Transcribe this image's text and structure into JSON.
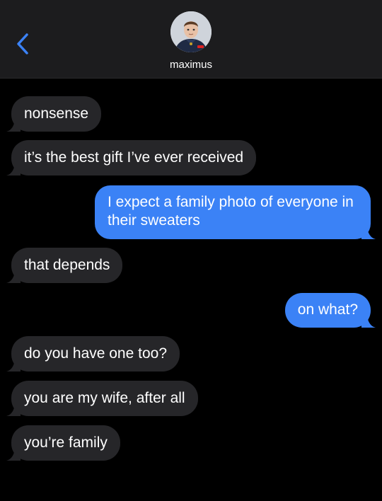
{
  "header": {
    "contact_name": "maximus",
    "back_icon": "chevron-left-icon",
    "avatar_icon": "contact-avatar"
  },
  "colors": {
    "accent": "#3b82f6",
    "received_bubble": "#262629",
    "background": "#000000",
    "header_bg": "#1c1c1e"
  },
  "messages": [
    {
      "from": "them",
      "text": "nonsense"
    },
    {
      "from": "them",
      "text": "it’s the best gift I’ve ever received"
    },
    {
      "from": "me",
      "text": "I expect a family photo of everyone in their sweaters"
    },
    {
      "from": "them",
      "text": "that depends"
    },
    {
      "from": "me",
      "text": "on what?"
    },
    {
      "from": "them",
      "text": "do you have one too?"
    },
    {
      "from": "them",
      "text": "you are my wife, after all"
    },
    {
      "from": "them",
      "text": "you’re family"
    }
  ]
}
